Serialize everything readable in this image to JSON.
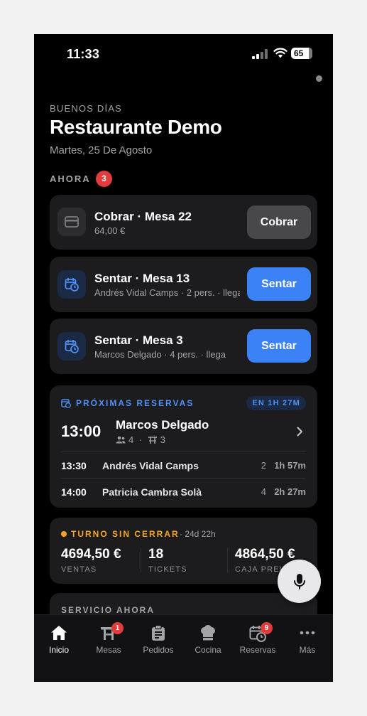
{
  "status": {
    "time": "11:33",
    "battery": "65"
  },
  "header": {
    "greeting": "BUENOS DÍAS",
    "restaurant": "Restaurante Demo",
    "date": "Martes, 25 De Agosto"
  },
  "now": {
    "label": "AHORA",
    "count": "3",
    "tasks": [
      {
        "title": "Cobrar · Mesa 22",
        "subtitle": "64,00 €",
        "action": "Cobrar",
        "icon": "card-icon"
      },
      {
        "title": "Sentar · Mesa 13",
        "subtitle": "Andrés Vidal Camps · 2 pers. · llega",
        "action": "Sentar",
        "icon": "calendar-clock-icon"
      },
      {
        "title": "Sentar · Mesa 3",
        "subtitle": "Marcos Delgado · 4 pers. · llega",
        "action": "Sentar",
        "icon": "calendar-clock-icon"
      }
    ]
  },
  "upcoming": {
    "heading": "PRÓXIMAS RESERVAS",
    "pill": "EN 1H 27M",
    "next": {
      "time": "13:00",
      "name": "Marcos Delgado",
      "people": "4",
      "table": "3"
    },
    "rows": [
      {
        "time": "13:30",
        "name": "Andrés Vidal Camps",
        "people": "2",
        "in": "1h 57m"
      },
      {
        "time": "14:00",
        "name": "Patricia Cambra Solà",
        "people": "4",
        "in": "2h 27m"
      }
    ]
  },
  "shift": {
    "heading": "TURNO SIN CERRAR",
    "since": "· 24d 22h",
    "stats": [
      {
        "value": "4694,50 €",
        "label": "VENTAS"
      },
      {
        "value": "18",
        "label": "TICKETS"
      },
      {
        "value": "4864,50 €",
        "label": "CAJA PREVISTA"
      }
    ]
  },
  "service": {
    "heading": "SERVICIO AHORA"
  },
  "tabs": [
    {
      "label": "Inicio",
      "icon": "home-icon",
      "badge": ""
    },
    {
      "label": "Mesas",
      "icon": "table-icon",
      "badge": "1"
    },
    {
      "label": "Pedidos",
      "icon": "clipboard-icon",
      "badge": ""
    },
    {
      "label": "Cocina",
      "icon": "chef-hat-icon",
      "badge": ""
    },
    {
      "label": "Reservas",
      "icon": "calendar-clock-icon",
      "badge": "9"
    },
    {
      "label": "Más",
      "icon": "more-icon",
      "badge": ""
    }
  ],
  "colors": {
    "accent": "#3b82f6",
    "warning": "#f5a623",
    "danger": "#e23b3b",
    "card": "#1c1c1e"
  }
}
